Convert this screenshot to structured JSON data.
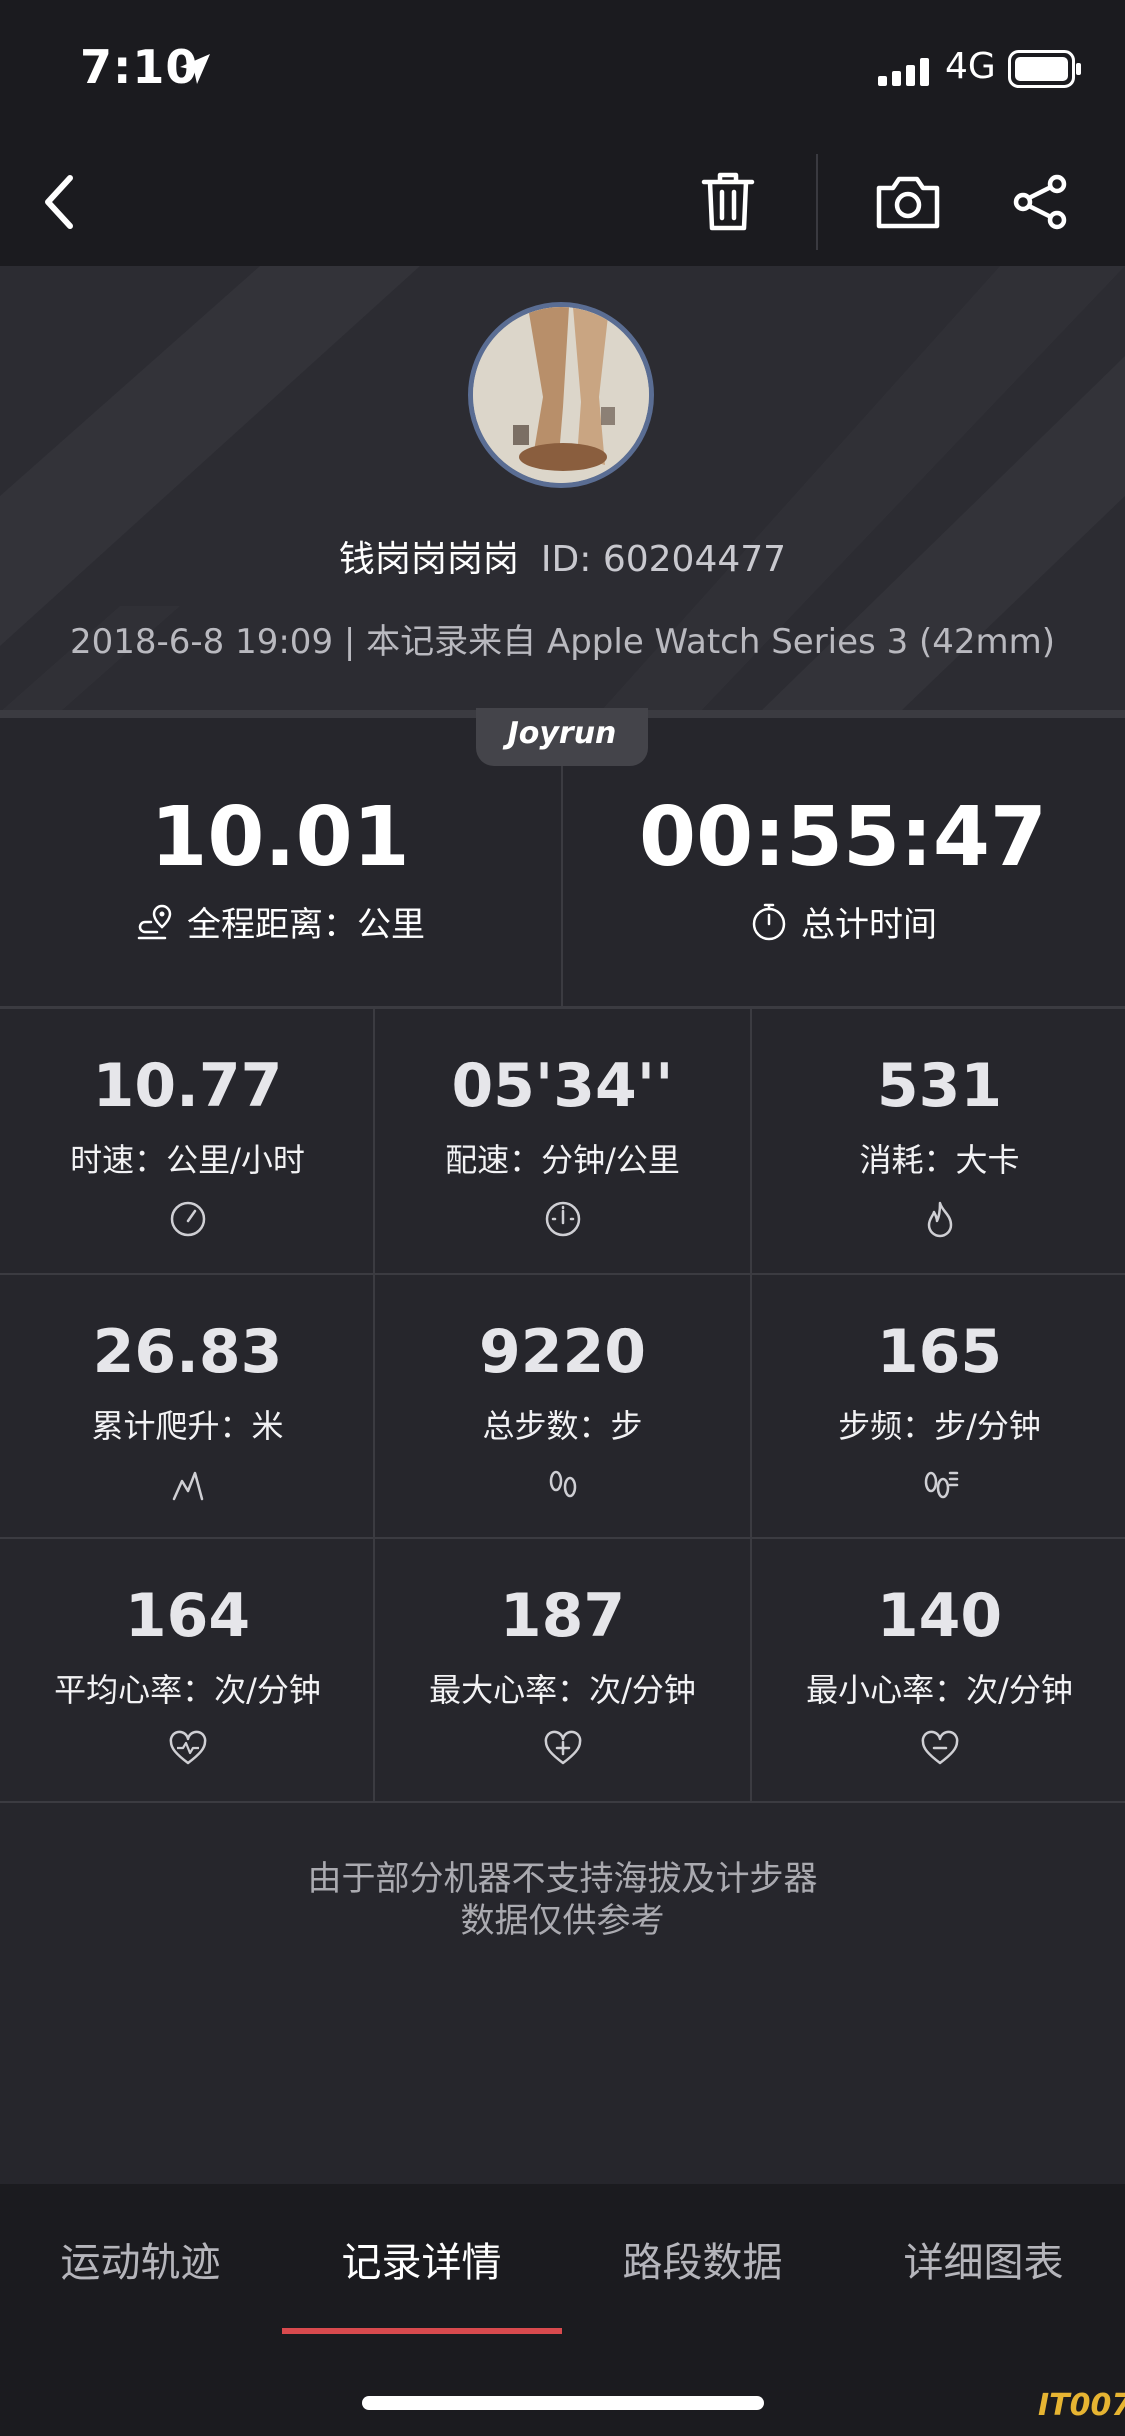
{
  "status_bar": {
    "time": "7:10",
    "network": "4G"
  },
  "icons": {
    "location": "location-arrow-icon",
    "signal": "cellular-signal-icon",
    "battery": "battery-icon",
    "back": "chevron-left-icon",
    "delete": "trash-icon",
    "camera": "camera-icon",
    "share": "share-icon"
  },
  "profile": {
    "name": "钱岗岗岗岗",
    "id": "ID: 60204477",
    "record_info": "2018-6-8 19:09 | 本记录来自 Apple Watch Series 3 (42mm)"
  },
  "brand": "Joyrun",
  "main_stats": [
    {
      "value": "10.01",
      "label": "全程距离：公里",
      "icon": "route-pin-icon"
    },
    {
      "value": "00:55:47",
      "label": "总计时间",
      "icon": "stopwatch-icon"
    }
  ],
  "stats": [
    {
      "value": "10.77",
      "label": "时速：公里/小时",
      "icon": "speedometer-icon"
    },
    {
      "value": "05'34''",
      "label": "配速：分钟/公里",
      "icon": "pace-gauge-icon"
    },
    {
      "value": "531",
      "label": "消耗：大卡",
      "icon": "flame-icon"
    },
    {
      "value": "26.83",
      "label": "累计爬升：米",
      "icon": "mountain-climb-icon"
    },
    {
      "value": "9220",
      "label": "总步数：步",
      "icon": "footprints-icon"
    },
    {
      "value": "165",
      "label": "步频：步/分钟",
      "icon": "cadence-footprints-icon"
    },
    {
      "value": "164",
      "label": "平均心率：次/分钟",
      "icon": "heart-pulse-icon"
    },
    {
      "value": "187",
      "label": "最大心率：次/分钟",
      "icon": "heart-plus-icon"
    },
    {
      "value": "140",
      "label": "最小心率：次/分钟",
      "icon": "heart-minus-icon"
    }
  ],
  "disclaimer": {
    "line1": "由于部分机器不支持海拔及计步器",
    "line2": "数据仅供参考"
  },
  "tabs": [
    {
      "label": "运动轨迹"
    },
    {
      "label": "记录详情"
    },
    {
      "label": "路段数据"
    },
    {
      "label": "详细图表"
    }
  ],
  "active_tab": "记录详情",
  "colors": {
    "accent": "#d94a4e",
    "background": "#26262c",
    "bar": "#1b1b1f"
  },
  "watermark": "IT007"
}
